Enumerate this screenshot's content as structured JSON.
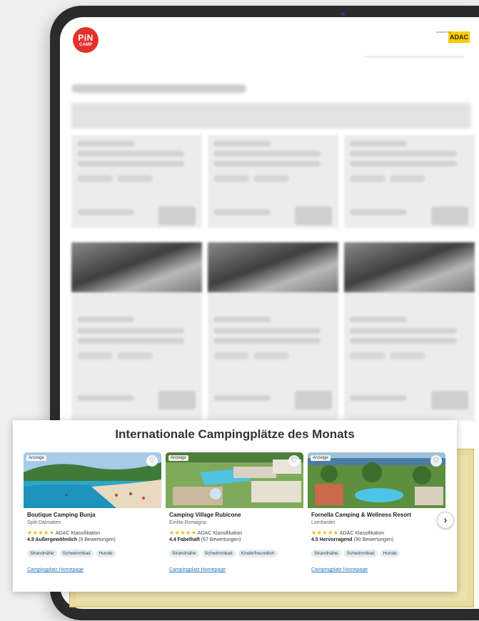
{
  "header": {
    "logo_line1": "PiN",
    "logo_line2": "CAMP",
    "partner_caption": "powered by",
    "partner_name": "ADAC"
  },
  "featured": {
    "title": "Internationale Campingplätze des Monats",
    "next_icon": "chevron-right-icon",
    "campsites": [
      {
        "badge": "Anzeige",
        "name": "Boutique Camping Bunja",
        "region": "Split-Dalmatien",
        "stars": "★★★★★",
        "classification": "ADAC Klassifikation",
        "score": "4.9 Außergewöhnlich",
        "reviews": "(9 Bewertungen)",
        "tags": [
          "Strandnähe",
          "Schwimmbad",
          "Hunde"
        ],
        "link": "Campingplatz Homepage"
      },
      {
        "badge": "Anzeige",
        "name": "Camping Village Rubicone",
        "region": "Emilia-Romagna",
        "stars": "★★★★★",
        "classification": "ADAC Klassifikation",
        "score": "4.4 Fabelhaft",
        "reviews": "(67 Bewertungen)",
        "tags": [
          "Strandnähe",
          "Schwimmbad",
          "Kinderfreundlich"
        ],
        "link": "Campingplatz Homepage"
      },
      {
        "badge": "Anzeige",
        "name": "Fornella Camping & Wellness Resort",
        "region": "Lombardei",
        "stars": "★★★★★",
        "classification": "ADAC Klassifikation",
        "score": "4.5 Hervorragend",
        "reviews": "(90 Bewertungen)",
        "tags": [
          "Strandnähe",
          "Schwimmbad",
          "Hunde"
        ],
        "link": "Campingplatz Homepage"
      }
    ]
  },
  "colors": {
    "brand_red": "#e4322b",
    "adac_yellow": "#ffcc00",
    "star_gold": "#f2b400",
    "link_blue": "#2b78c2"
  }
}
